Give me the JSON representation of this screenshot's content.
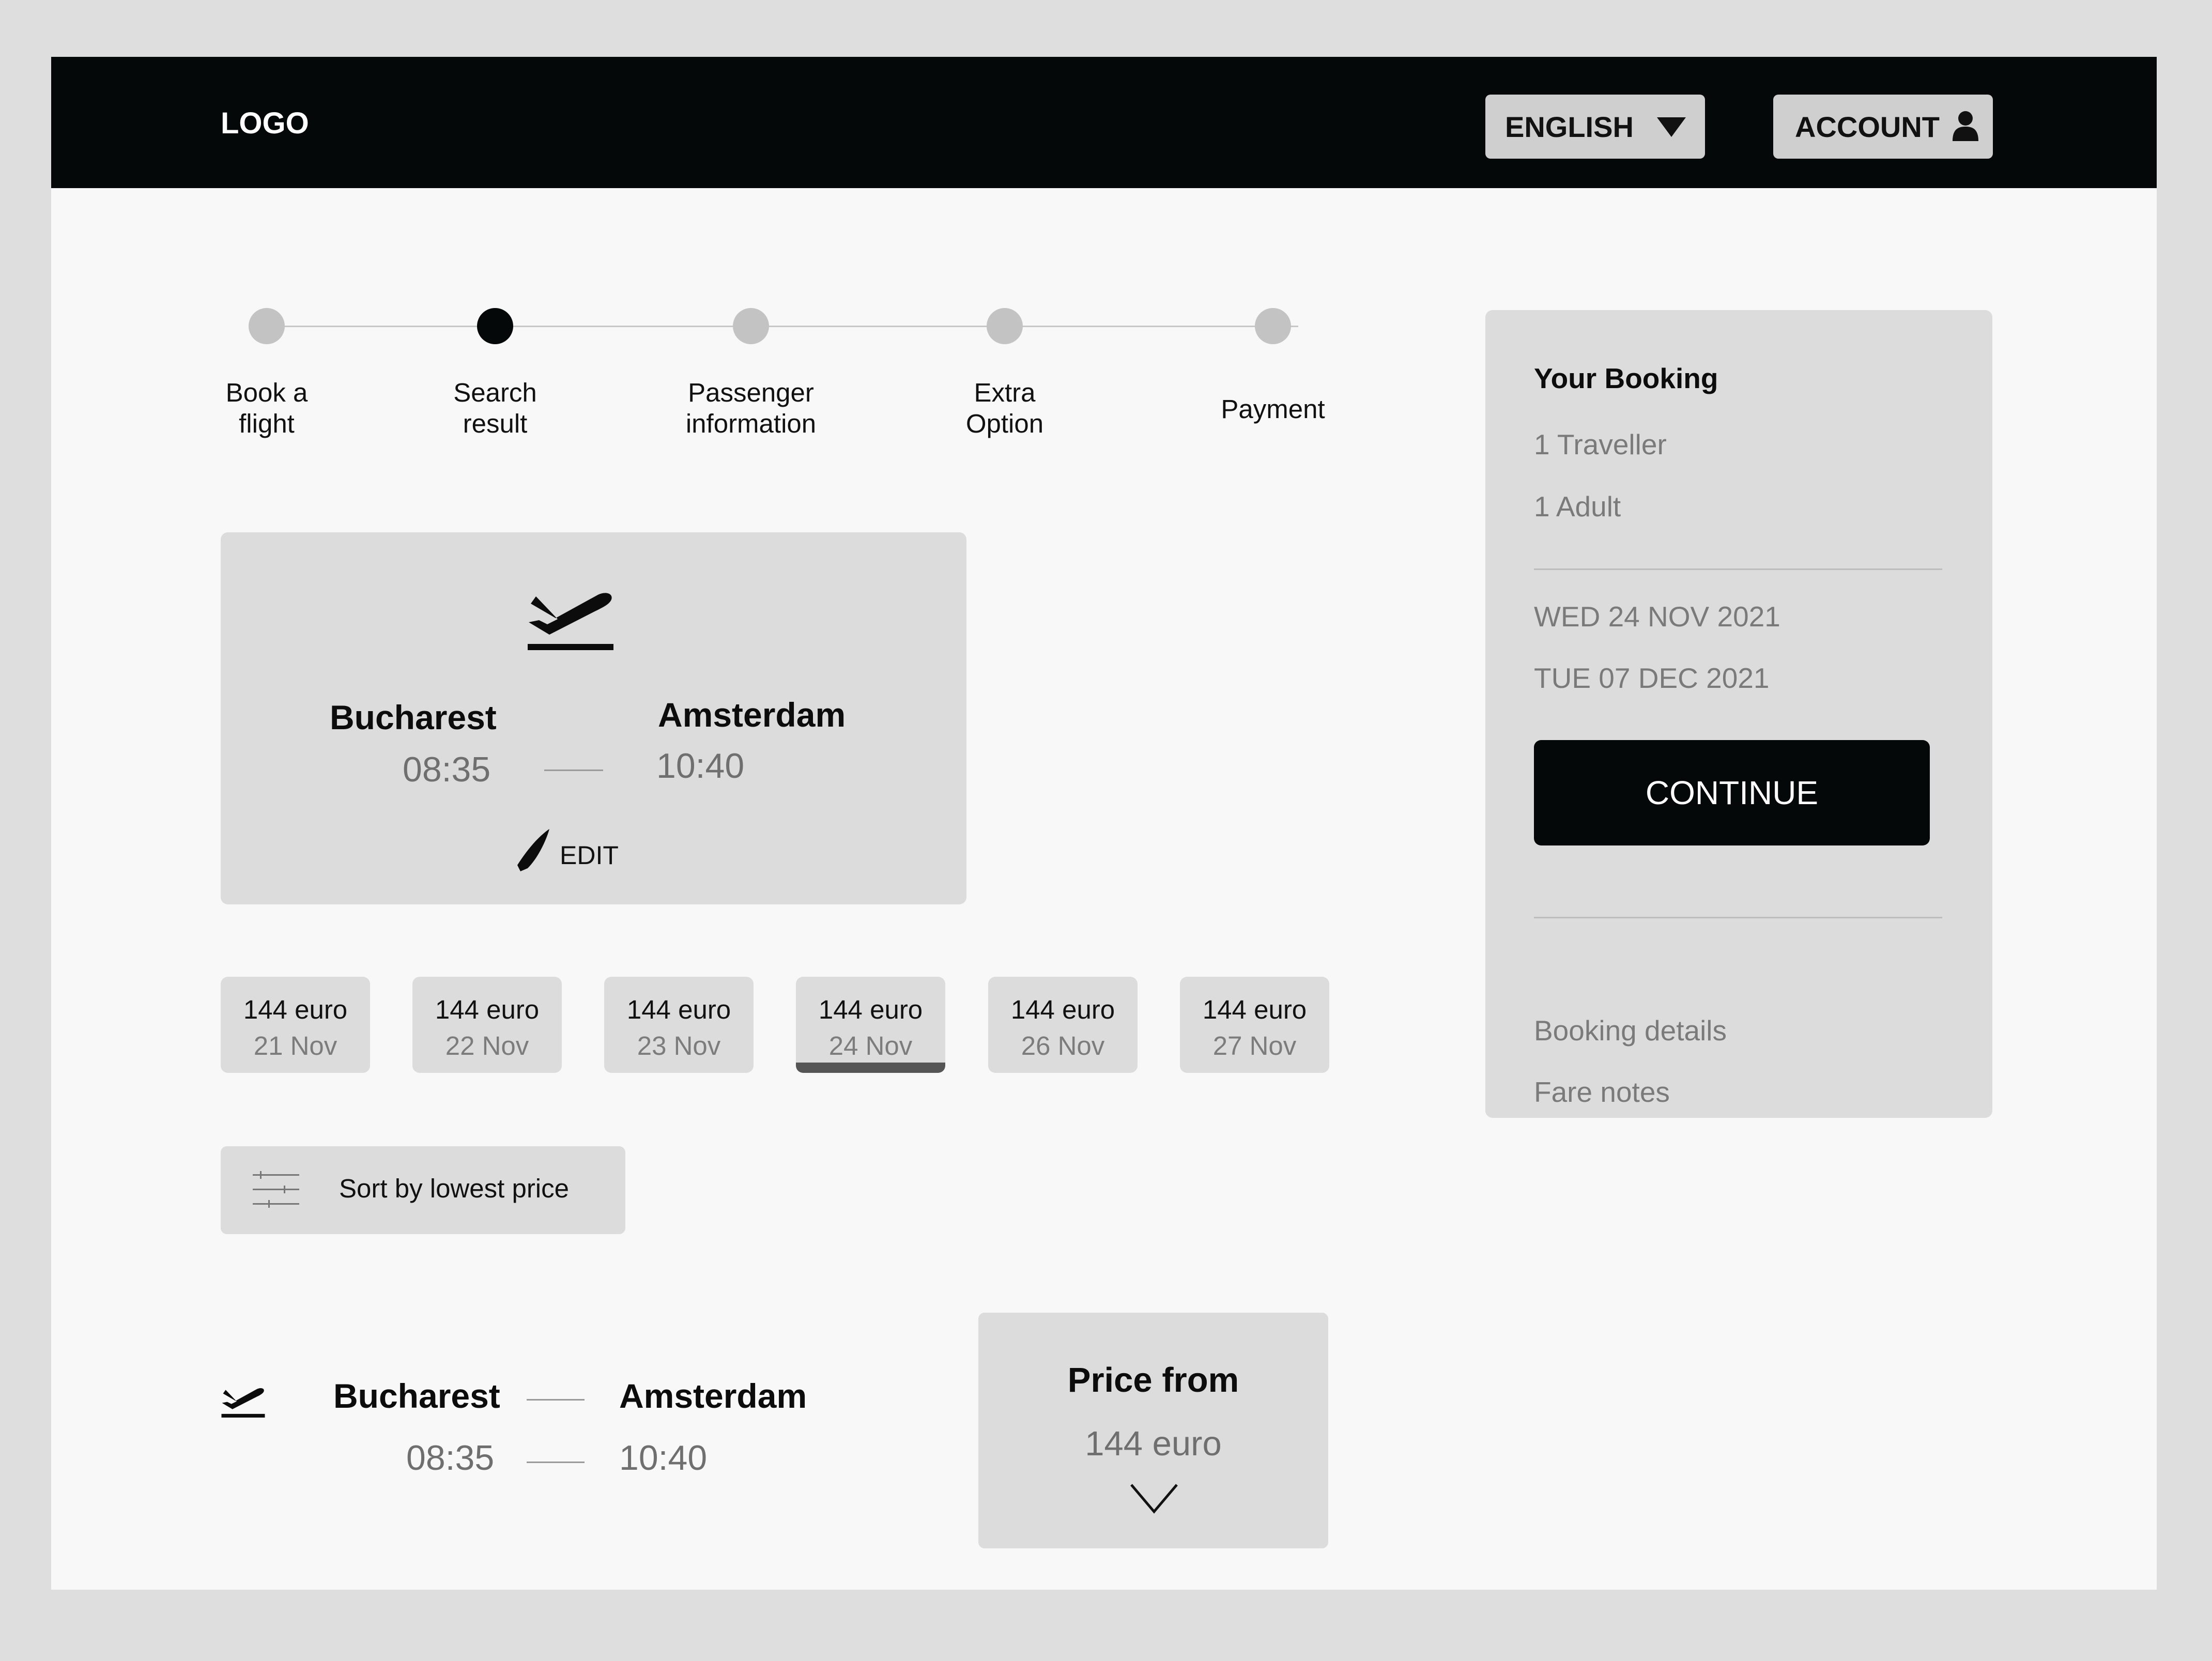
{
  "header": {
    "logo": "LOGO",
    "language": "ENGLISH",
    "account": "ACCOUNT"
  },
  "stepper": {
    "steps": [
      {
        "label": "Book a\nflight"
      },
      {
        "label": "Search\nresult"
      },
      {
        "label": "Passenger\ninformation"
      },
      {
        "label": "Extra\nOption"
      },
      {
        "label": "Payment"
      }
    ],
    "active_step": "Search\nresult"
  },
  "flight_card": {
    "from_city": "Bucharest",
    "from_time": "08:35",
    "to_city": "Amsterdam",
    "to_time": "10:40",
    "edit_label": "EDIT"
  },
  "date_tabs": [
    {
      "price": "144 euro",
      "date": "21 Nov"
    },
    {
      "price": "144 euro",
      "date": "22 Nov"
    },
    {
      "price": "144 euro",
      "date": "23 Nov"
    },
    {
      "price": "144 euro",
      "date": "24 Nov"
    },
    {
      "price": "144 euro",
      "date": "26 Nov"
    },
    {
      "price": "144 euro",
      "date": "27 Nov"
    }
  ],
  "selected_date": "24 Nov",
  "sort": {
    "label": "Sort by lowest price"
  },
  "result": {
    "from_city": "Bucharest",
    "from_time": "08:35",
    "to_city": "Amsterdam",
    "to_time": "10:40",
    "price_title": "Price from",
    "price_value": "144 euro"
  },
  "booking": {
    "title": "Your Booking",
    "travellers": "1 Traveller",
    "adults": "1 Adult",
    "depart_date": "WED 24 NOV 2021",
    "return_date": "TUE 07 DEC 2021",
    "continue_label": "CONTINUE",
    "details_link": "Booking details",
    "fare_link": "Fare notes"
  },
  "colors": {
    "header_bg": "#050809",
    "page_bg": "#f8f8f8",
    "card_bg": "#dcdcdc",
    "active": "#050809",
    "muted_text": "#7a7a7a"
  }
}
